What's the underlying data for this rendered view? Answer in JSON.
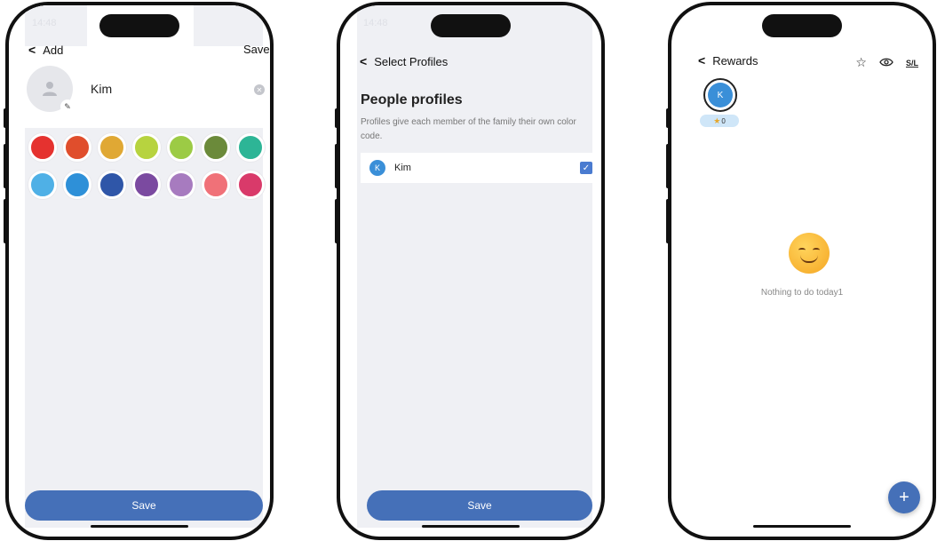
{
  "add_screen": {
    "status_time": "14:48",
    "back_label": "Add",
    "save_top_label": "Save",
    "name_value": "Kim",
    "colors_row1": [
      "#e5322f",
      "#e04e2c",
      "#e0a834",
      "#b7d33f",
      "#9ccb45",
      "#6b8a3a",
      "#2db596"
    ],
    "colors_row2": [
      "#4fb0e6",
      "#2e90d8",
      "#2f56a8",
      "#7b4aa0",
      "#a77bbf",
      "#f07178",
      "#d93a6a"
    ],
    "save_label": "Save"
  },
  "select_screen": {
    "status_time": "14:48",
    "back_label": "Select Profiles",
    "section_title": "People profiles",
    "description": "Profiles give each member of the family their own color code.",
    "profile_initial": "K",
    "profile_name": "Kim",
    "checked": true,
    "save_label": "Save"
  },
  "rewards_screen": {
    "back_label": "Rewards",
    "sl_label": "S/L",
    "avatar_initial": "K",
    "points": "0",
    "empty_text": "Nothing to do today1",
    "fab_label": "+"
  },
  "icons": {
    "back": "chevron-left-icon",
    "person": "person-icon",
    "edit": "pencil-icon",
    "clear": "clear-icon",
    "star": "star-outline-icon",
    "eye": "eye-icon",
    "add": "plus-icon"
  }
}
